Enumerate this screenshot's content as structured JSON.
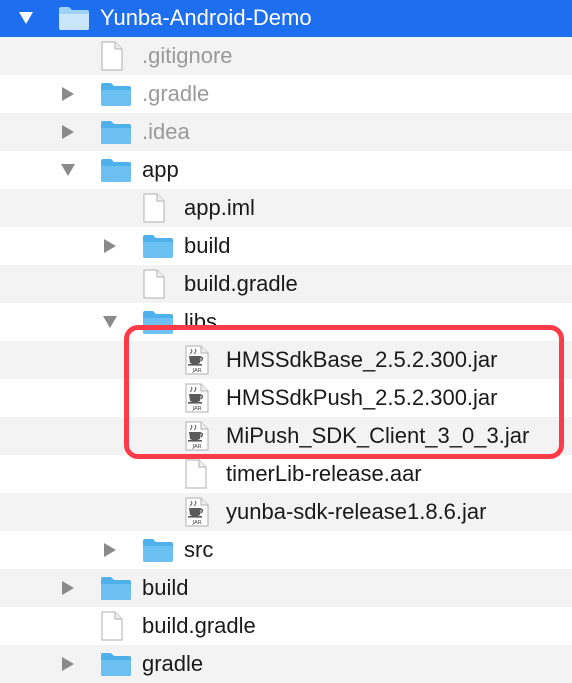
{
  "tree": {
    "items": [
      {
        "label": "Yunba-Android-Demo",
        "kind": "folder",
        "state": "open",
        "depth": 0,
        "selected": true,
        "muted": false
      },
      {
        "label": ".gitignore",
        "kind": "file",
        "state": "none",
        "depth": 1,
        "selected": false,
        "muted": true
      },
      {
        "label": ".gradle",
        "kind": "folder",
        "state": "closed",
        "depth": 1,
        "selected": false,
        "muted": true
      },
      {
        "label": ".idea",
        "kind": "folder",
        "state": "closed",
        "depth": 1,
        "selected": false,
        "muted": true
      },
      {
        "label": "app",
        "kind": "folder",
        "state": "open",
        "depth": 1,
        "selected": false,
        "muted": false
      },
      {
        "label": "app.iml",
        "kind": "file",
        "state": "none",
        "depth": 2,
        "selected": false,
        "muted": false
      },
      {
        "label": "build",
        "kind": "folder",
        "state": "closed",
        "depth": 2,
        "selected": false,
        "muted": false
      },
      {
        "label": "build.gradle",
        "kind": "file",
        "state": "none",
        "depth": 2,
        "selected": false,
        "muted": false
      },
      {
        "label": "libs",
        "kind": "folder",
        "state": "open",
        "depth": 2,
        "selected": false,
        "muted": false
      },
      {
        "label": "HMSSdkBase_2.5.2.300.jar",
        "kind": "jar",
        "state": "none",
        "depth": 3,
        "selected": false,
        "muted": false
      },
      {
        "label": "HMSSdkPush_2.5.2.300.jar",
        "kind": "jar",
        "state": "none",
        "depth": 3,
        "selected": false,
        "muted": false
      },
      {
        "label": "MiPush_SDK_Client_3_0_3.jar",
        "kind": "jar",
        "state": "none",
        "depth": 3,
        "selected": false,
        "muted": false
      },
      {
        "label": "timerLib-release.aar",
        "kind": "file",
        "state": "none",
        "depth": 3,
        "selected": false,
        "muted": false
      },
      {
        "label": "yunba-sdk-release1.8.6.jar",
        "kind": "jar",
        "state": "none",
        "depth": 3,
        "selected": false,
        "muted": false
      },
      {
        "label": "src",
        "kind": "folder",
        "state": "closed",
        "depth": 2,
        "selected": false,
        "muted": false
      },
      {
        "label": "build",
        "kind": "folder",
        "state": "closed",
        "depth": 1,
        "selected": false,
        "muted": false
      },
      {
        "label": "build.gradle",
        "kind": "file",
        "state": "none",
        "depth": 1,
        "selected": false,
        "muted": false
      },
      {
        "label": "gradle",
        "kind": "folder",
        "state": "closed",
        "depth": 1,
        "selected": false,
        "muted": false
      }
    ]
  },
  "jar_badge": "JAR",
  "colors": {
    "selection": "#1e6ff0",
    "highlight": "#ff3b4a",
    "folder": "#4fb1ec",
    "folder_dark": "#3a9de0",
    "muted_text": "#9a9a9a",
    "alt_row": "#f3f3f3"
  }
}
